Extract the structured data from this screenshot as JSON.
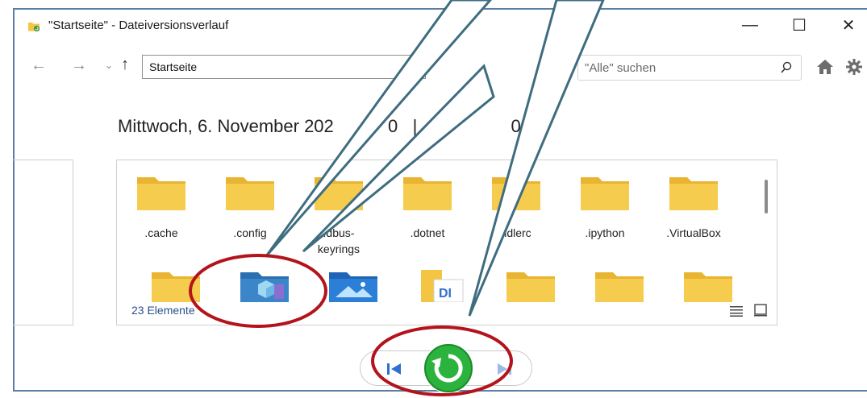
{
  "window": {
    "title": "\"Startseite\" - Dateiversionsverlauf",
    "minimize": "—",
    "maximize": "☐",
    "close": "✕"
  },
  "nav": {
    "back": "←",
    "forward": "→",
    "recent": "⌄",
    "up": "↑",
    "address": "Startseite",
    "search_placeholder": "\"Alle\" suchen"
  },
  "heading": "Mittwoch, 6. November 202           0   |   70            08",
  "files": {
    "row1": [
      ".cache",
      ".config",
      ".dbus-keyrings",
      ".dotnet",
      ".idlerc",
      ".ipython",
      ".VirtualBox"
    ],
    "status": "23 Elemente"
  },
  "colors": {
    "folder": "#f4c542",
    "callout_stroke": "#3f6d80",
    "ellipse": "#b3141b",
    "restore_green": "#1f9e2e",
    "nav_blue": "#2f6fd1"
  },
  "icons": {
    "search": "search-icon",
    "home": "home-icon",
    "settings": "gear-icon",
    "previous": "previous-version-icon",
    "next": "next-version-icon",
    "restore": "restore-icon"
  }
}
